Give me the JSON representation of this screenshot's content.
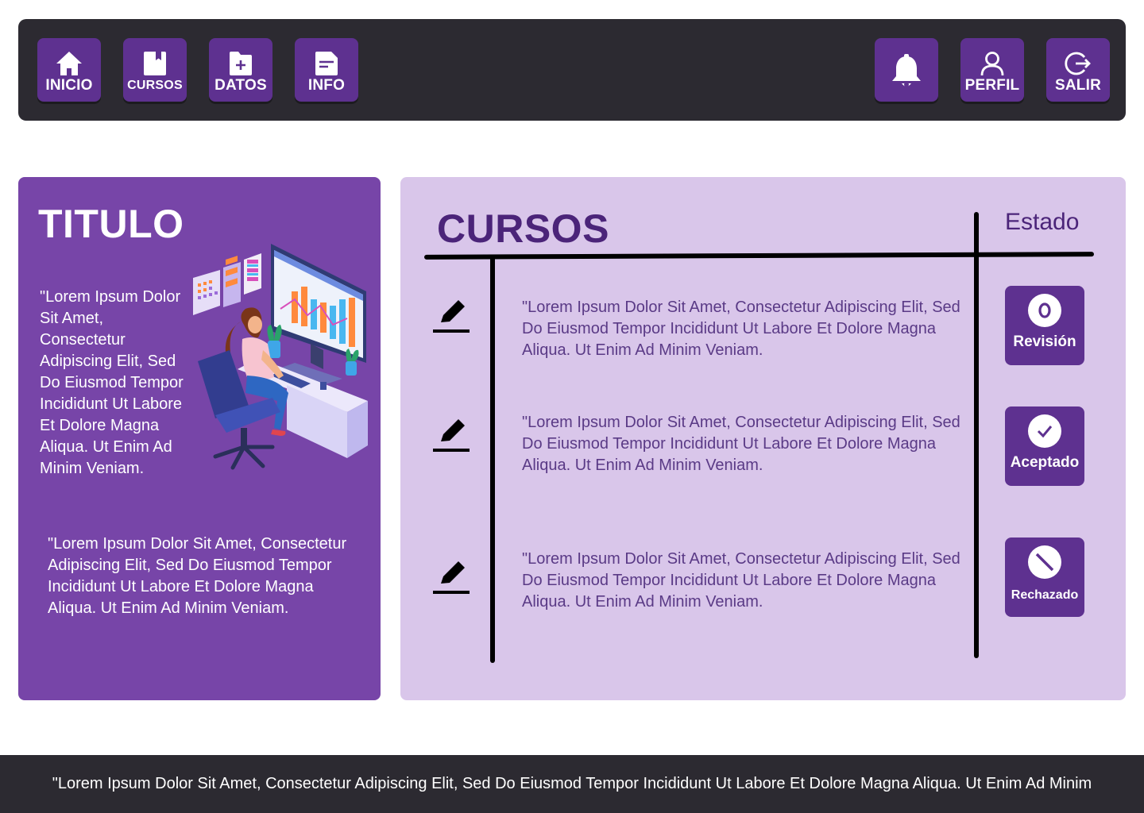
{
  "nav": {
    "left": [
      {
        "label": "INICIO",
        "icon": "home-icon"
      },
      {
        "label": "CURSOS",
        "icon": "book-icon"
      },
      {
        "label": "DATOS",
        "icon": "file-add-icon"
      },
      {
        "label": "INFO",
        "icon": "document-icon"
      }
    ],
    "right": [
      {
        "label": "",
        "icon": "bell-icon"
      },
      {
        "label": "PERFIL",
        "icon": "user-icon"
      },
      {
        "label": "SALIR",
        "icon": "logout-icon"
      }
    ]
  },
  "left_card": {
    "title": "TITULO",
    "paragraph1": "\"Lorem Ipsum Dolor Sit Amet, Consectetur Adipiscing Elit, Sed Do Eiusmod Tempor Incididunt Ut Labore Et Dolore Magna Aliqua. Ut Enim Ad Minim Veniam.",
    "paragraph2": "\"Lorem Ipsum Dolor Sit Amet, Consectetur Adipiscing Elit, Sed Do Eiusmod Tempor Incididunt Ut Labore Et Dolore Magna Aliqua. Ut Enim Ad Minim Veniam.",
    "illustration": "woman-at-computer-illustration"
  },
  "courses": {
    "title": "CURSOS",
    "status_header": "Estado",
    "rows": [
      {
        "text": "\"Lorem Ipsum Dolor Sit Amet, Consectetur Adipiscing Elit, Sed Do Eiusmod Tempor Incididunt Ut Labore Et Dolore Magna Aliqua. Ut Enim Ad Minim Veniam.",
        "status": "Revisión",
        "status_icon": "eye-icon"
      },
      {
        "text": "\"Lorem Ipsum Dolor Sit Amet, Consectetur Adipiscing Elit, Sed Do Eiusmod Tempor Incididunt Ut Labore Et Dolore Magna Aliqua. Ut Enim Ad Minim Veniam.",
        "status": "Aceptado",
        "status_icon": "check-icon"
      },
      {
        "text": "\"Lorem Ipsum Dolor Sit Amet, Consectetur Adipiscing Elit, Sed Do Eiusmod Tempor Incididunt Ut Labore Et Dolore Magna Aliqua. Ut Enim Ad Minim Veniam.",
        "status": "Rechazado",
        "status_icon": "ban-icon"
      }
    ]
  },
  "footer": {
    "text": "\"Lorem Ipsum Dolor Sit Amet, Consectetur Adipiscing Elit, Sed Do Eiusmod Tempor Incididunt Ut Labore Et Dolore Magna Aliqua. Ut Enim Ad Minim"
  },
  "colors": {
    "topbar": "#2c2a31",
    "button": "#5e3190",
    "left_card": "#7745a8",
    "right_card": "#d9c6ea",
    "heading": "#4b2479"
  }
}
